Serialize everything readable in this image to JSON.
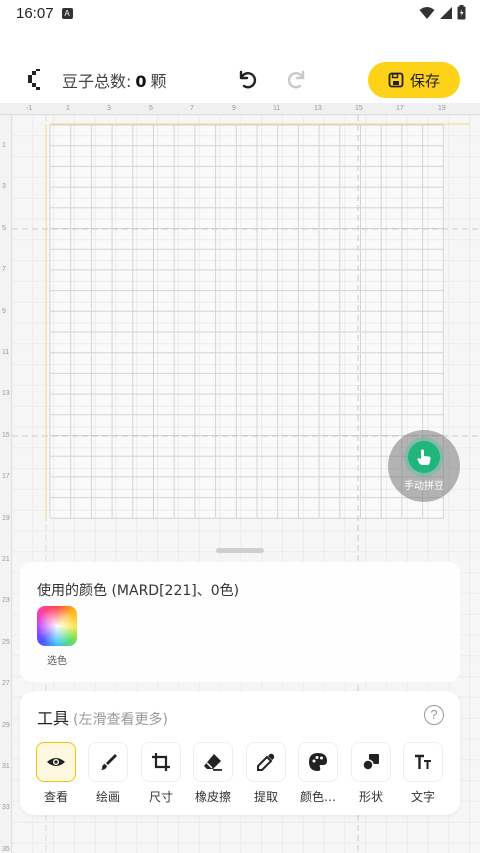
{
  "status_bar": {
    "time": "16:07",
    "badge": "A"
  },
  "header": {
    "bean_total_label": "豆子总数:",
    "bean_total_count": "0",
    "bean_total_unit": "颗",
    "save_label": "保存"
  },
  "rulers": {
    "top": [
      "-1",
      "1",
      "3",
      "5",
      "7",
      "9",
      "11",
      "13",
      "15",
      "17",
      "19"
    ],
    "left": [
      "1",
      "3",
      "5",
      "7",
      "9",
      "11",
      "13",
      "15",
      "17",
      "19",
      "21",
      "23",
      "25",
      "27",
      "29",
      "31",
      "33",
      "35"
    ]
  },
  "fab": {
    "label": "手动拼豆"
  },
  "colors_panel": {
    "title": "使用的颜色 (MARD[221]、0色)",
    "picker_label": "选色"
  },
  "tools_panel": {
    "title": "工具",
    "hint": "(左滑查看更多)",
    "help": "?",
    "tools": [
      {
        "label": "查看",
        "icon": "eye-icon"
      },
      {
        "label": "绘画",
        "icon": "brush-icon"
      },
      {
        "label": "尺寸",
        "icon": "crop-icon"
      },
      {
        "label": "橡皮擦",
        "icon": "eraser-icon"
      },
      {
        "label": "提取",
        "icon": "eyedropper-icon"
      },
      {
        "label": "颜色…",
        "icon": "palette-icon"
      },
      {
        "label": "形状",
        "icon": "shapes-icon"
      },
      {
        "label": "文字",
        "icon": "text-icon"
      }
    ]
  },
  "colors": {
    "accent": "#ffd21a",
    "fab": "#1fb57b"
  }
}
